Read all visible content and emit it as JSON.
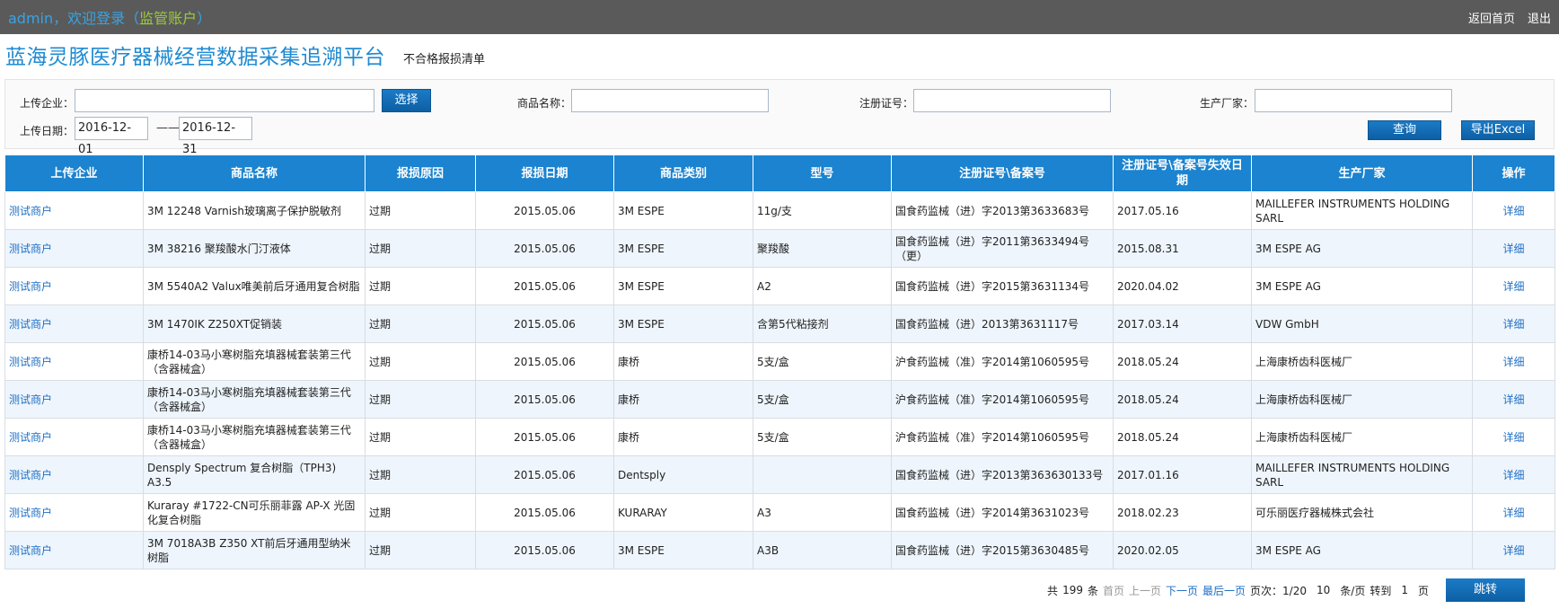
{
  "topbar": {
    "welcome_prefix": "admin，欢迎登录（",
    "role": "监管账户",
    "welcome_suffix": "）",
    "home_link": "返回首页",
    "logout_link": "退出"
  },
  "header": {
    "platform_title": "蓝海灵豚医疗器械经营数据采集追溯平台",
    "page_subtitle": "不合格报损清单"
  },
  "filters": {
    "company_label": "上传企业：",
    "company_value": "",
    "select_button": "选择",
    "product_label": "商品名称：",
    "product_value": "",
    "reg_label": "注册证号：",
    "reg_value": "",
    "maker_label": "生产厂家：",
    "maker_value": "",
    "date_label": "上传日期：",
    "date_from": "2016-12-01",
    "date_separator": "——",
    "date_to": "2016-12-31",
    "query_button": "查询",
    "export_button": "导出Excel"
  },
  "table": {
    "columns": [
      "上传企业",
      "商品名称",
      "报损原因",
      "报损日期",
      "商品类别",
      "型号",
      "注册证号\\备案号",
      "注册证号\\备案号失效日期",
      "生产厂家",
      "操作"
    ],
    "rows": [
      [
        "测试商户",
        "3M 12248 Varnish玻璃离子保护脱敏剂",
        "过期",
        "2015.05.06",
        "3M ESPE",
        "11g/支",
        "国食药监械（进）字2013第3633683号",
        "2017.05.16",
        "MAILLEFER INSTRUMENTS HOLDING SARL",
        "详细"
      ],
      [
        "测试商户",
        "3M 38216 聚羧酸水门汀液体",
        "过期",
        "2015.05.06",
        "3M ESPE",
        "聚羧酸",
        "国食药监械（进）字2011第3633494号（更）",
        "2015.08.31",
        "3M ESPE AG",
        "详细"
      ],
      [
        "测试商户",
        "3M 5540A2 Valux唯美前后牙通用复合树脂",
        "过期",
        "2015.05.06",
        "3M ESPE",
        "A2",
        "国食药监械（进）字2015第3631134号",
        "2020.04.02",
        "3M ESPE AG",
        "详细"
      ],
      [
        "测试商户",
        "3M 1470IK Z250XT促销装",
        "过期",
        "2015.05.06",
        "3M ESPE",
        "含第5代粘接剂",
        "国食药监械（进）2013第3631117号",
        "2017.03.14",
        "VDW GmbH",
        "详细"
      ],
      [
        "测试商户",
        "康桥14-03马小寒树脂充填器械套装第三代（含器械盒）",
        "过期",
        "2015.05.06",
        "康桥",
        "5支/盒",
        "沪食药监械（准）字2014第1060595号",
        "2018.05.24",
        "上海康桥齿科医械厂",
        "详细"
      ],
      [
        "测试商户",
        "康桥14-03马小寒树脂充填器械套装第三代（含器械盒）",
        "过期",
        "2015.05.06",
        "康桥",
        "5支/盒",
        "沪食药监械（准）字2014第1060595号",
        "2018.05.24",
        "上海康桥齿科医械厂",
        "详细"
      ],
      [
        "测试商户",
        "康桥14-03马小寒树脂充填器械套装第三代（含器械盒）",
        "过期",
        "2015.05.06",
        "康桥",
        "5支/盒",
        "沪食药监械（准）字2014第1060595号",
        "2018.05.24",
        "上海康桥齿科医械厂",
        "详细"
      ],
      [
        "测试商户",
        "Densply Spectrum 复合树脂（TPH3) A3.5",
        "过期",
        "2015.05.06",
        "Dentsply",
        "",
        "国食药监械（进）字2013第363630133号",
        "2017.01.16",
        "MAILLEFER INSTRUMENTS HOLDING SARL",
        "详细"
      ],
      [
        "测试商户",
        "Kuraray #1722-CN可乐丽菲露 AP-X 光固化复合树脂",
        "过期",
        "2015.05.06",
        "KURARAY",
        "A3",
        "国食药监械（进）字2014第3631023号",
        "2018.02.23",
        "可乐丽医疗器械株式会社",
        "详细"
      ],
      [
        "测试商户",
        "3M 7018A3B Z350 XT前后牙通用型纳米树脂",
        "过期",
        "2015.05.06",
        "3M ESPE",
        "A3B",
        "国食药监械（进）字2015第3630485号",
        "2020.02.05",
        "3M ESPE AG",
        "详细"
      ]
    ]
  },
  "pager": {
    "total_prefix": "共",
    "total": "199",
    "total_suffix": "条",
    "first": "首页",
    "prev": "上一页",
    "next": "下一页",
    "last": "最后一页",
    "page_label": "页次：1/20",
    "page_size": "10",
    "page_size_suffix": "条/页",
    "goto_label": "转到",
    "goto_value": "1",
    "goto_suffix": "页",
    "go_button": "跳转"
  },
  "colors": {
    "topbar": "#5a5a5a",
    "accent": "#1b83cf",
    "title": "#1e8ad2",
    "role": "#9ccb3b",
    "row_alt": "#eef5fc"
  }
}
